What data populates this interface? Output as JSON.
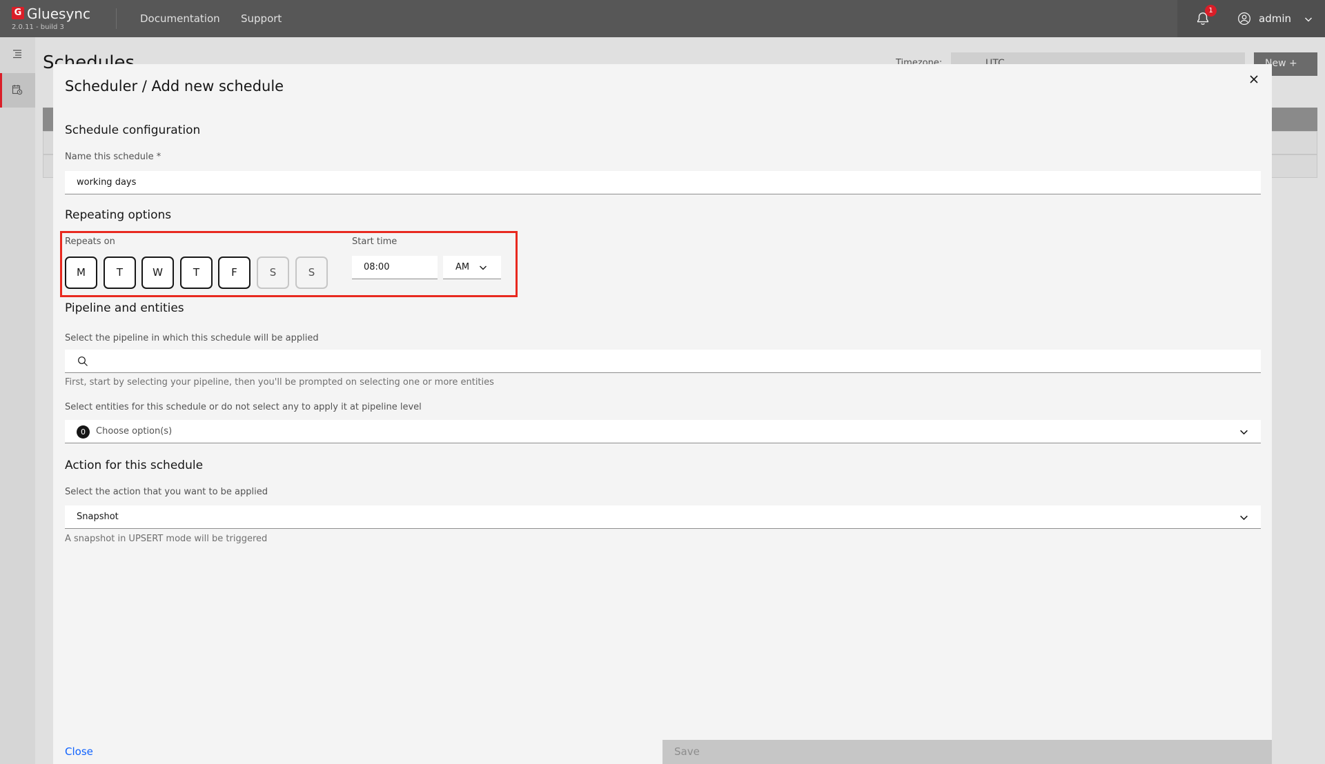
{
  "header": {
    "brand_letter": "G",
    "brand_name": "Gluesync",
    "version": "2.0.11 - build 3",
    "nav": [
      "Documentation",
      "Support"
    ],
    "notifications_count": "1",
    "user_name": "admin"
  },
  "background": {
    "page_title": "Schedules",
    "timezone_label": "Timezone:",
    "timezone_value": "UTC",
    "new_button": "New  +"
  },
  "modal": {
    "title": "Scheduler / Add new schedule",
    "schedule_configuration": {
      "heading": "Schedule configuration",
      "name_label": "Name this schedule *",
      "name_value": "working days"
    },
    "repeating": {
      "heading": "Repeating options",
      "repeats_on_label": "Repeats on",
      "days": [
        {
          "label": "M",
          "selected": true
        },
        {
          "label": "T",
          "selected": true
        },
        {
          "label": "W",
          "selected": true
        },
        {
          "label": "T",
          "selected": true
        },
        {
          "label": "F",
          "selected": true
        },
        {
          "label": "S",
          "selected": false
        },
        {
          "label": "S",
          "selected": false
        }
      ],
      "start_time_label": "Start time",
      "start_time_value": "08:00",
      "period": "AM"
    },
    "pipeline": {
      "heading": "Pipeline and entities",
      "pipeline_label": "Select the pipeline in which this schedule will be applied",
      "pipeline_search_value": "",
      "pipeline_helper": "First, start by selecting your pipeline, then you'll be prompted on selecting one or more entities",
      "entities_label": "Select entities for this schedule or do not select any to apply it at pipeline level",
      "entities_count": "0",
      "entities_placeholder": "Choose option(s)"
    },
    "action": {
      "heading": "Action for this schedule",
      "action_label": "Select the action that you want to be applied",
      "action_value": "Snapshot",
      "action_helper": "A snapshot in UPSERT mode will be triggered"
    },
    "footer": {
      "close_label": "Close",
      "save_label": "Save"
    }
  },
  "colors": {
    "accent_red": "#da1e28",
    "highlight": "#e8291f",
    "link_blue": "#0f62fe"
  }
}
